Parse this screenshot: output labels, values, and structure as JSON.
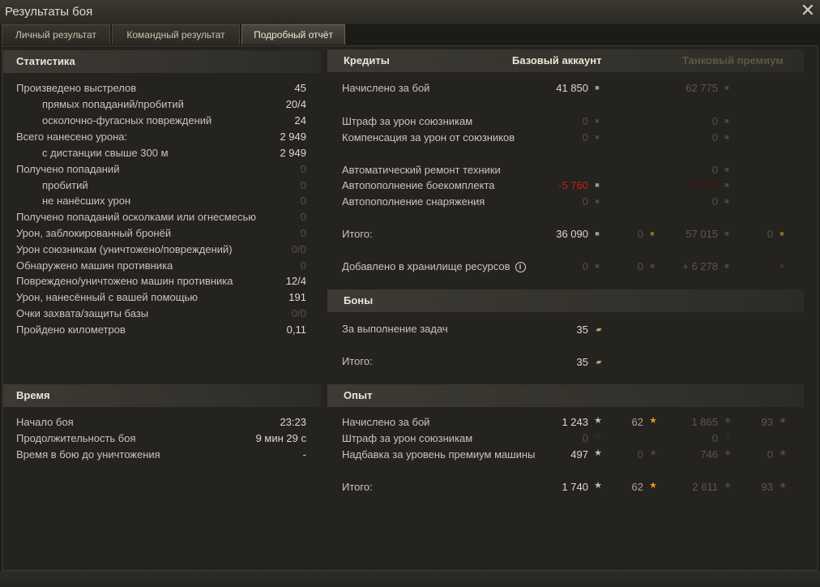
{
  "window": {
    "title": "Результаты боя",
    "close_glyph": "✕"
  },
  "tabs": [
    "Личный результат",
    "Командный результат",
    "Подробный отчёт"
  ],
  "stats": {
    "header": "Статистика",
    "rows": [
      {
        "label": "Произведено выстрелов",
        "value": "45"
      },
      {
        "label": "прямых попаданий/пробитий",
        "value": "20/4"
      },
      {
        "label": "осколочно-фугасных повреждений",
        "value": "24"
      },
      {
        "label": "Всего нанесено урона:",
        "value": "2 949"
      },
      {
        "label": "с дистанции свыше 300 м",
        "value": "2 949"
      },
      {
        "label": "Получено попаданий",
        "value": "0"
      },
      {
        "label": "пробитий",
        "value": "0"
      },
      {
        "label": "не нанёсших урон",
        "value": "0"
      },
      {
        "label": "Получено попаданий осколками или огнесмесью",
        "value": "0"
      },
      {
        "label": "Урон, заблокированный бронёй",
        "value": "0"
      },
      {
        "label": "Урон союзникам (уничтожено/повреждений)",
        "value": "0/0"
      },
      {
        "label": "Обнаружено машин противника",
        "value": "0"
      },
      {
        "label": "Повреждено/уничтожено машин противника",
        "value": "12/4"
      },
      {
        "label": "Урон, нанесённый с вашей помощью",
        "value": "191"
      },
      {
        "label": "Очки захвата/защиты базы",
        "value": "0/0"
      },
      {
        "label": "Пройдено километров",
        "value": "0,11"
      }
    ]
  },
  "time": {
    "header": "Время",
    "rows": [
      {
        "label": "Начало боя",
        "value": "23:23"
      },
      {
        "label": "Продолжительность боя",
        "value": "9 мин 29 с"
      },
      {
        "label": "Время в бою до уничтожения",
        "value": "-"
      }
    ]
  },
  "credits": {
    "header": "Кредиты",
    "col_base": "Базовый аккаунт",
    "col_premium": "Танковый премиум",
    "rows": [
      {
        "label": "Начислено за бой",
        "base": "41 850",
        "prem": "62 775"
      },
      {
        "label": "Штраф за урон союзникам",
        "base": "0",
        "prem": "0"
      },
      {
        "label": "Компенсация за урон от союзников",
        "base": "0",
        "prem": "0"
      },
      {
        "label": "Автоматический ремонт техники",
        "base": "",
        "prem": "0"
      },
      {
        "label": "Автопополнение боекомплекта",
        "base": "-5 760",
        "prem": "-5 760"
      },
      {
        "label": "Автопополнение снаряжения",
        "base": "0",
        "prem": "0"
      }
    ],
    "total": {
      "label": "Итого:",
      "base": "36 090",
      "base_gold": "0",
      "prem": "57 015",
      "prem_gold": "0"
    },
    "storage": {
      "label": "Добавлено в хранилище ресурсов",
      "base": "0",
      "base_gold": "0",
      "prem": "+ 6 278",
      "prem_gold": "0"
    }
  },
  "bonds": {
    "header": "Боны",
    "rows": [
      {
        "label": "За выполнение задач",
        "value": "35"
      },
      {
        "label": "Итого:",
        "value": "35"
      }
    ]
  },
  "xp": {
    "header": "Опыт",
    "rows": [
      {
        "label": "Начислено за бой",
        "base": "1 243",
        "base_free": "62",
        "prem": "1 865",
        "prem_free": "93"
      },
      {
        "label": "Штраф за урон союзникам",
        "base": "0",
        "base_free": "",
        "prem": "0",
        "prem_free": ""
      },
      {
        "label": "Надбавка за уровень премиум машины",
        "base": "497",
        "base_free": "0",
        "prem": "746",
        "prem_free": "0"
      }
    ],
    "total": {
      "label": "Итого:",
      "base": "1 740",
      "base_free": "62",
      "prem": "2 611",
      "prem_free": "93"
    }
  },
  "icons": {
    "credit": "credit-icon",
    "gold": "gold-icon",
    "bond": "bond-icon",
    "xp": "xp-star-icon",
    "free_xp": "free-xp-star-icon",
    "info": "info-icon"
  }
}
